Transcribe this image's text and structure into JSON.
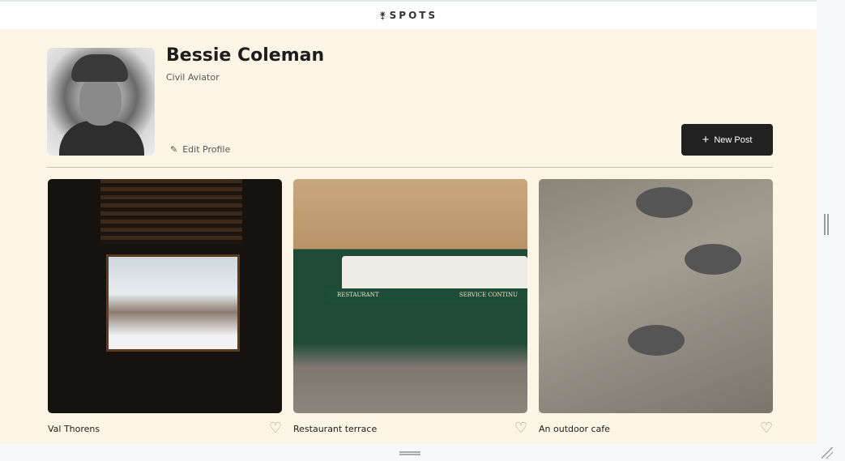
{
  "header": {
    "logo_text": "SPOTS"
  },
  "profile": {
    "name": "Bessie Coleman",
    "description": "Civil Aviator",
    "edit_label": "Edit Profile",
    "new_post_label": "New Post"
  },
  "cards": [
    {
      "title": "Val Thorens",
      "liked": false
    },
    {
      "title": "Restaurant terrace",
      "liked": false
    },
    {
      "title": "An outdoor cafe",
      "liked": false
    }
  ],
  "image_text": {
    "sign_left": "RESTAURANT",
    "sign_right": "SERVICE CONTINU"
  }
}
